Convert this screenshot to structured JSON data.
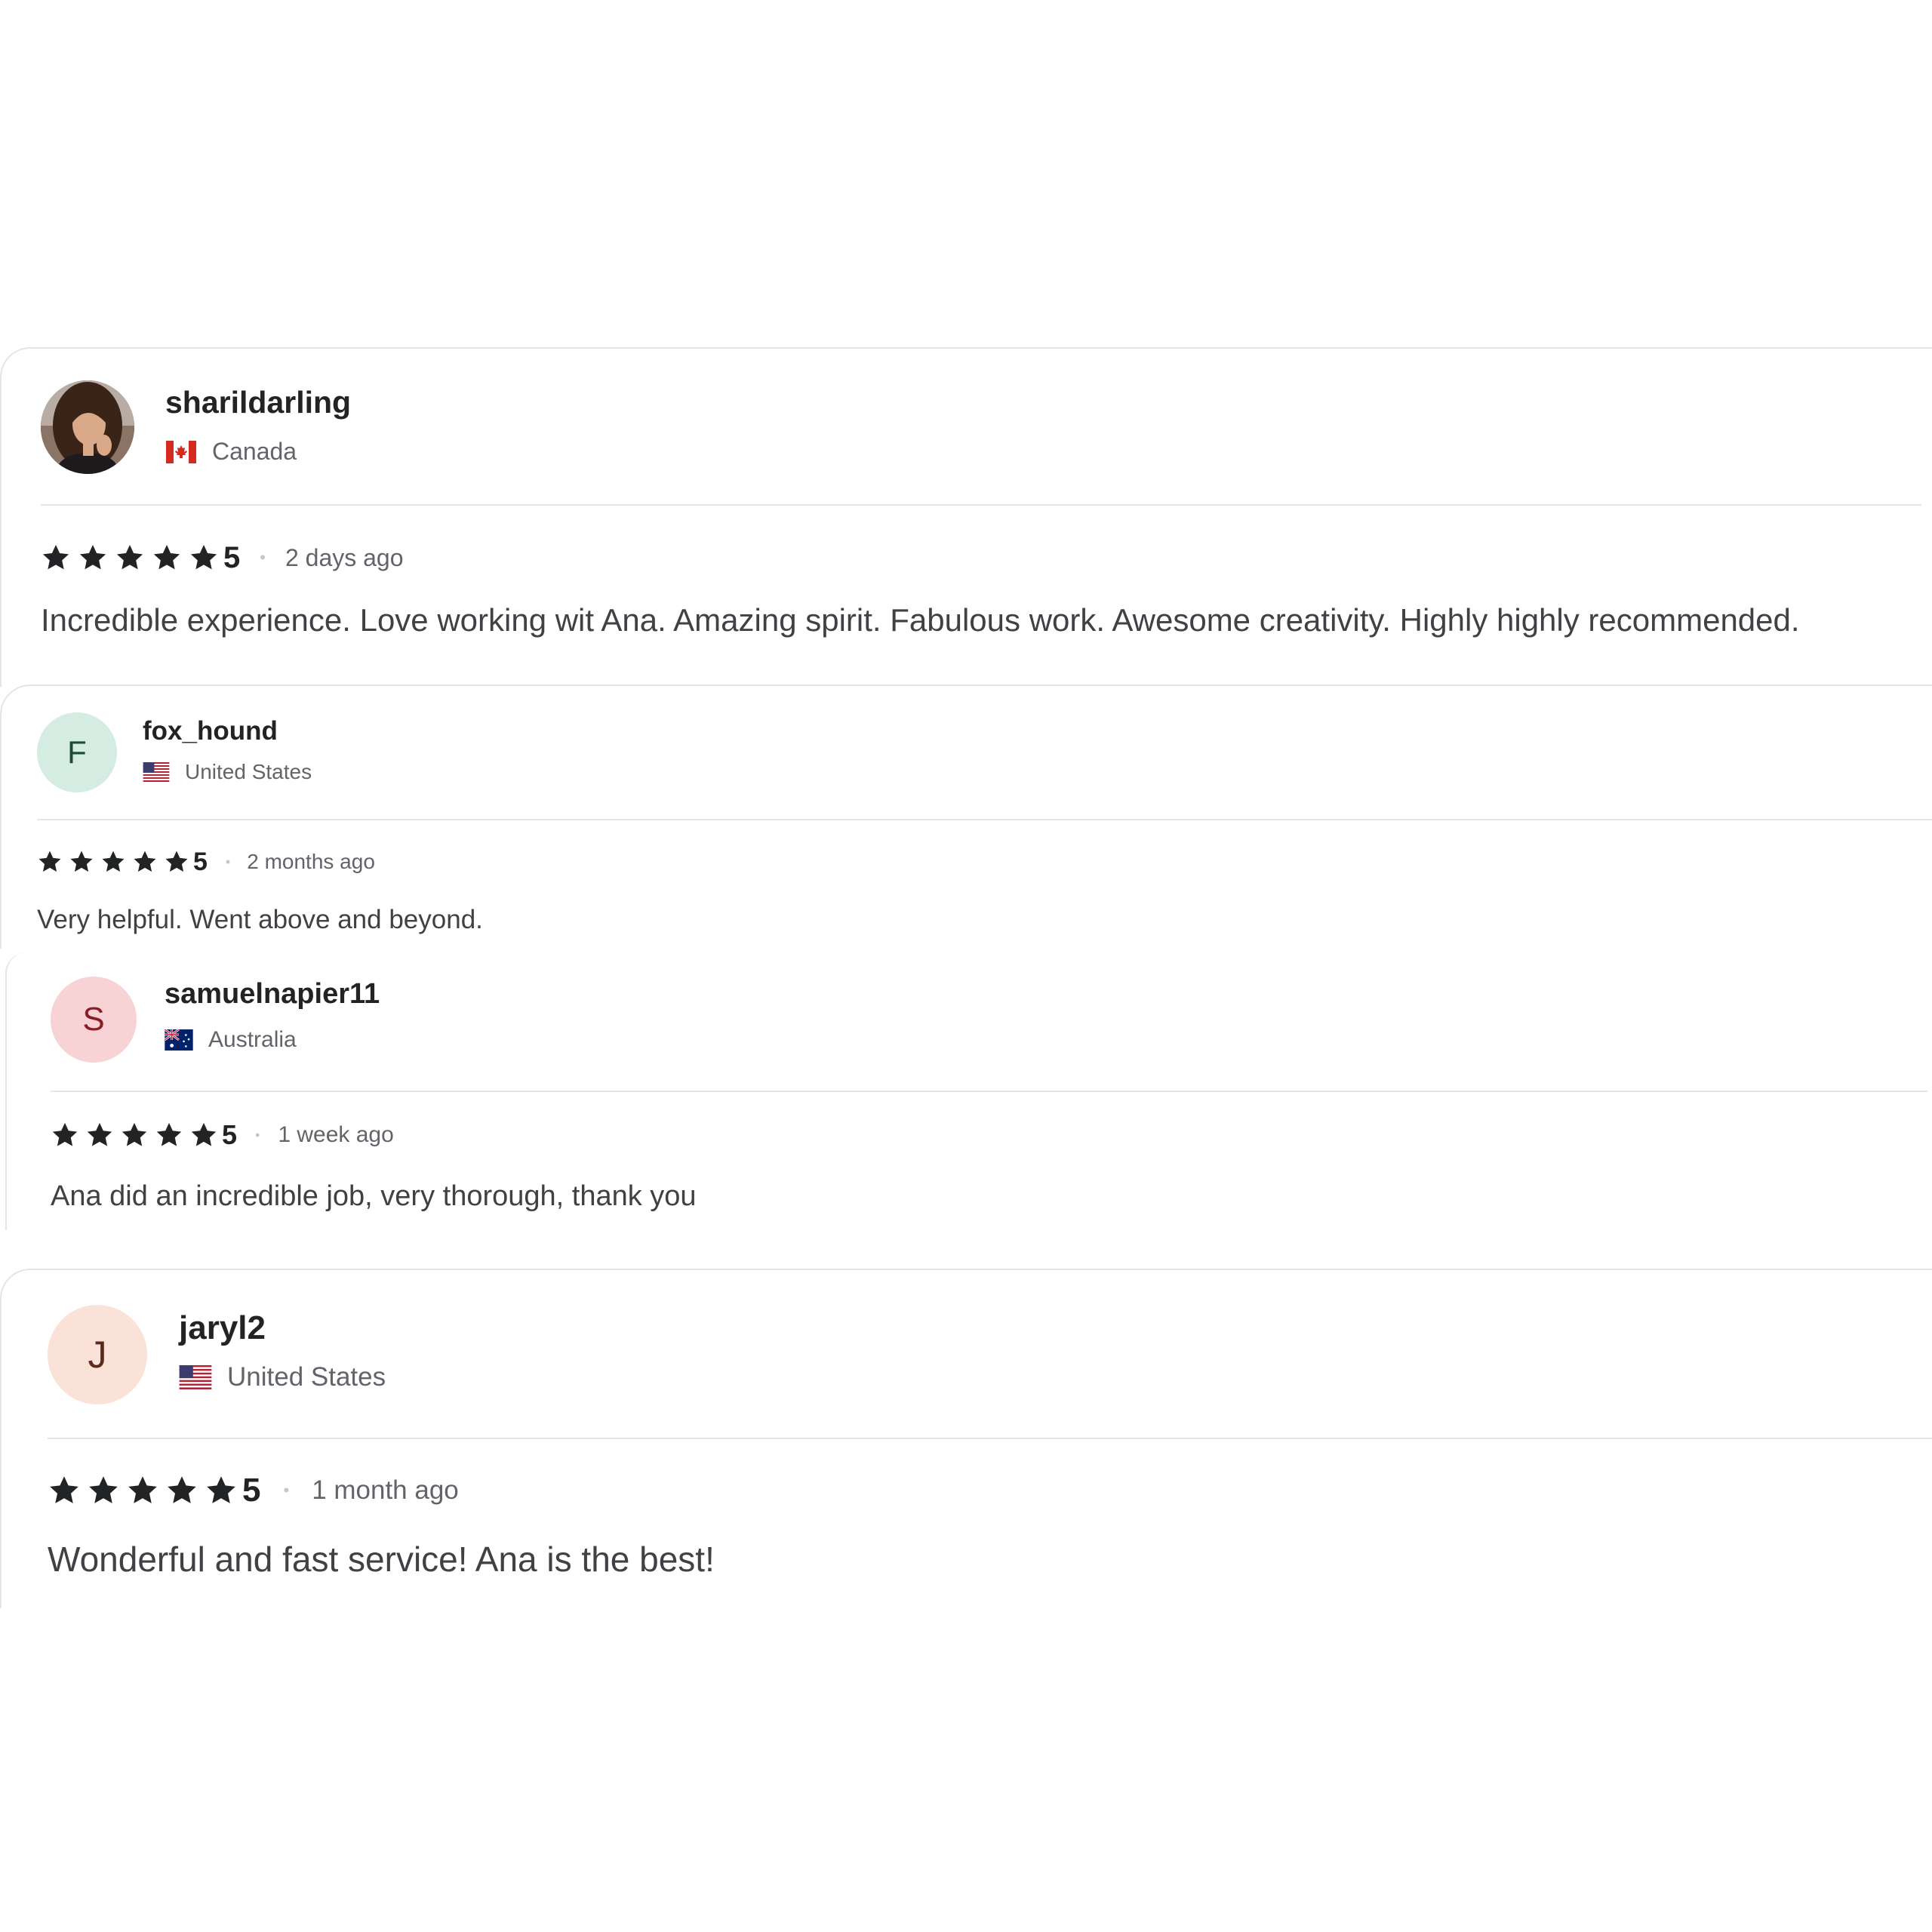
{
  "reviews": [
    {
      "username": "sharildarling",
      "country": "Canada",
      "flag": "flag-canada-icon",
      "avatar_type": "photo",
      "rating": "5",
      "time_ago": "2 days ago",
      "text": "Incredible experience. Love working wit Ana. Amazing spirit. Fabulous work. Awesome creativity. Highly highly recommended."
    },
    {
      "username": "fox_hound",
      "country": "United States",
      "flag": "flag-united-states-icon",
      "avatar_initial": "F",
      "avatar_bg": "#d5ece3",
      "avatar_fg": "#1e4c3a",
      "rating": "5",
      "time_ago": "2 months ago",
      "text": "Very helpful. Went above and beyond."
    },
    {
      "username": "samuelnapier11",
      "country": "Australia",
      "flag": "flag-australia-icon",
      "avatar_initial": "S",
      "avatar_bg": "#f8d3d6",
      "avatar_fg": "#8a1c24",
      "rating": "5",
      "time_ago": "1 week ago",
      "text": "Ana did an incredible job, very thorough, thank you"
    },
    {
      "username": "jaryl2",
      "country": "United States",
      "flag": "flag-united-states-icon",
      "avatar_initial": "J",
      "avatar_bg": "#fbe2d9",
      "avatar_fg": "#5b2a1a",
      "rating": "5",
      "time_ago": "1 month ago",
      "text": "Wonderful and fast service! Ana is the best!"
    }
  ],
  "separator": "•",
  "colors": {
    "text_primary": "#222325",
    "text_secondary": "#62646a",
    "divider": "#e4e5e7",
    "star": "#222325"
  }
}
